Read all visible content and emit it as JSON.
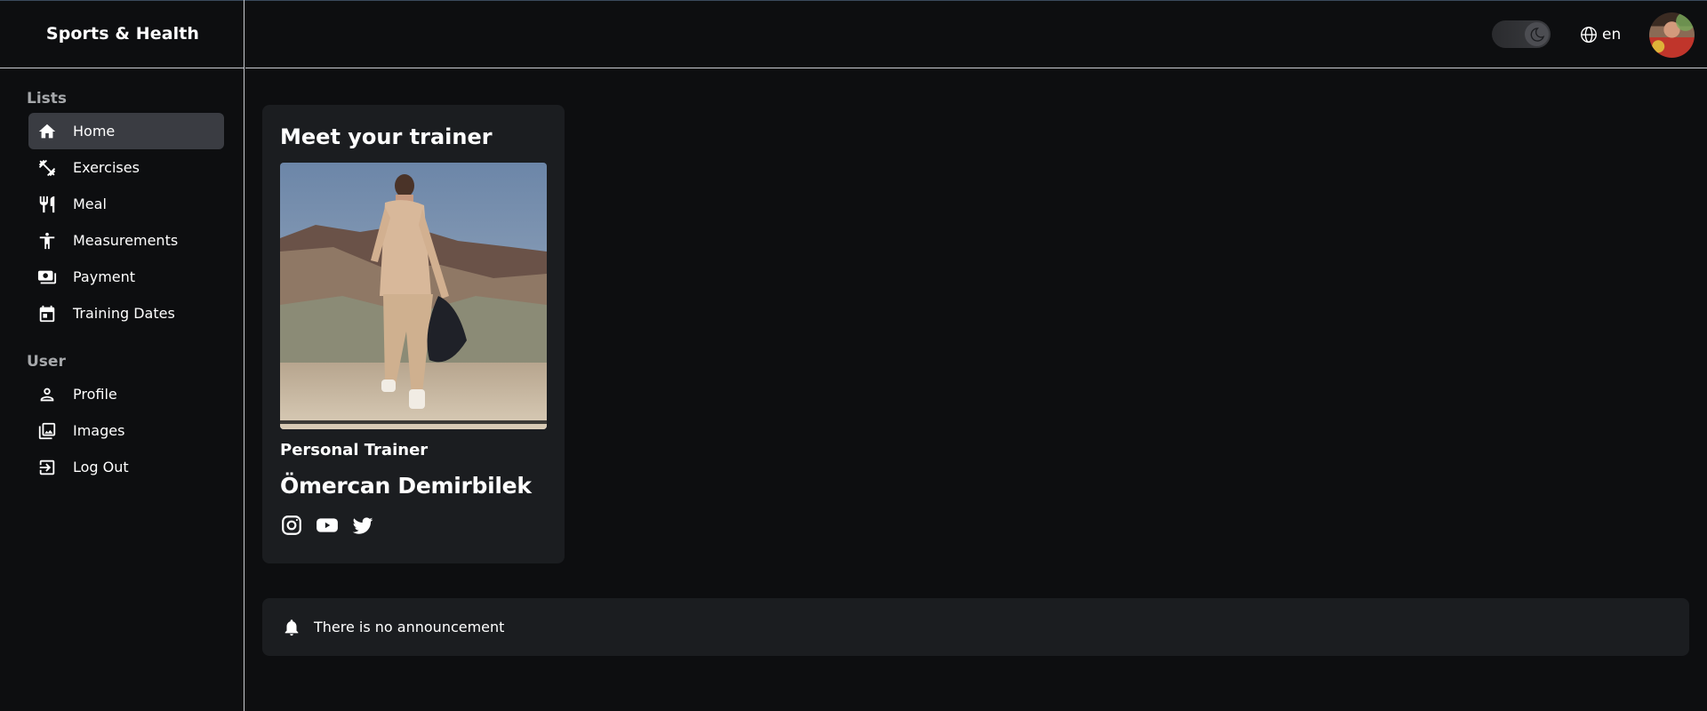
{
  "app": {
    "title": "Sports & Health"
  },
  "sidebar": {
    "sections": [
      {
        "title": "Lists"
      },
      {
        "title": "User"
      }
    ],
    "lists": [
      {
        "label": "Home",
        "icon": "home-icon",
        "active": true
      },
      {
        "label": "Exercises",
        "icon": "dumbbell-icon"
      },
      {
        "label": "Meal",
        "icon": "utensils-icon"
      },
      {
        "label": "Measurements",
        "icon": "person-icon"
      },
      {
        "label": "Payment",
        "icon": "payment-icon"
      },
      {
        "label": "Training Dates",
        "icon": "calendar-icon"
      }
    ],
    "user": [
      {
        "label": "Profile",
        "icon": "user-icon"
      },
      {
        "label": "Images",
        "icon": "images-icon"
      },
      {
        "label": "Log Out",
        "icon": "logout-icon"
      }
    ]
  },
  "header": {
    "theme_toggle": {
      "icon": "moon-icon",
      "mode": "dark"
    },
    "language": {
      "label": "en",
      "icon": "globe-icon"
    },
    "avatar": {
      "icon": "avatar"
    }
  },
  "trainer_card": {
    "title": "Meet your trainer",
    "role": "Personal Trainer",
    "name": "Ömercan Demirbilek",
    "socials": [
      "instagram-icon",
      "youtube-icon",
      "twitter-icon"
    ]
  },
  "announcement": {
    "icon": "bell-icon",
    "text": "There is no announcement"
  },
  "colors": {
    "background": "#0d0e10",
    "card": "#1b1d20",
    "active_nav": "#3a3c42",
    "muted_text": "#a6a8ab"
  }
}
